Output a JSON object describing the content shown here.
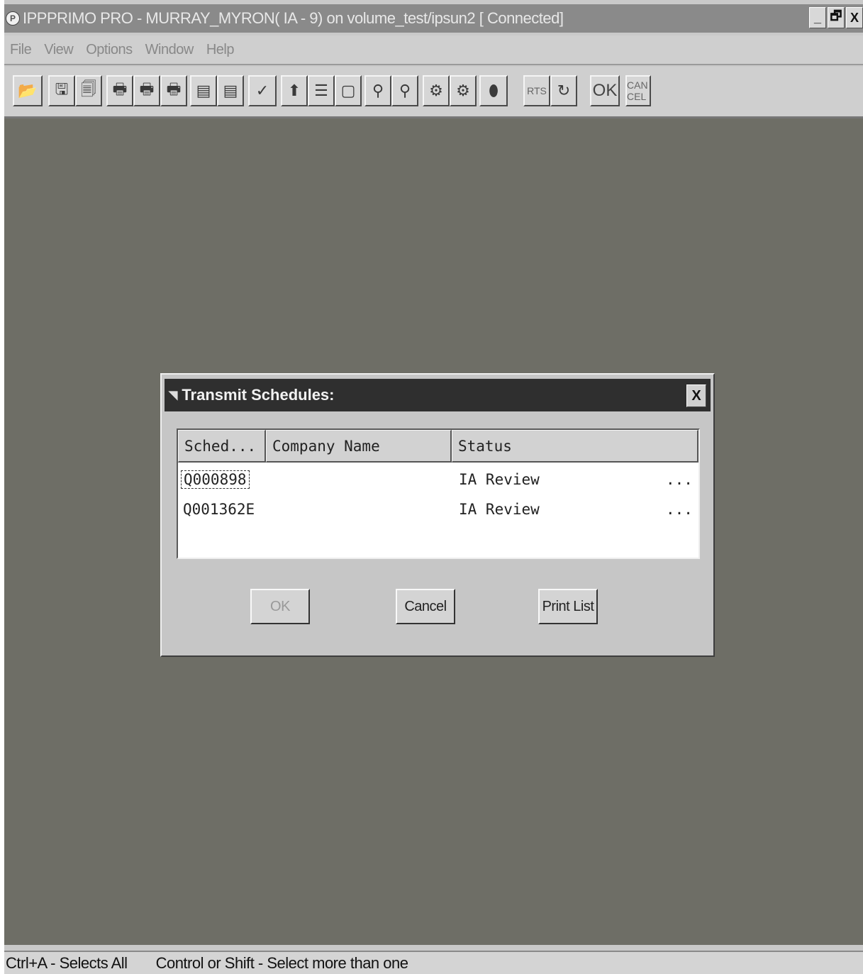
{
  "window": {
    "title": "IPPPRIMO PRO - MURRAY_MYRON( IA - 9) on volume_test/ipsun2 [ Connected]",
    "app_icon_letter": "P",
    "controls": [
      "_",
      "🗗",
      "X"
    ]
  },
  "menu": {
    "items": [
      "File",
      "View",
      "Options",
      "Window",
      "Help"
    ]
  },
  "toolbar": {
    "rts_label": "RTS",
    "ok_label": "OK",
    "cancel_label": "CAN CEL"
  },
  "dialog": {
    "title": "Transmit Schedules:",
    "close_label": "X",
    "columns": [
      "Sched...",
      "Company Name",
      "Status"
    ],
    "rows": [
      {
        "sched": "Q000898",
        "company": "",
        "status": "IA Review",
        "more": "..."
      },
      {
        "sched": "Q001362E",
        "company": "",
        "status": "IA Review",
        "more": "..."
      }
    ],
    "ok_label": "OK",
    "cancel_label": "Cancel",
    "print_label": "Print List"
  },
  "status_bar": {
    "hint_select_all": "Ctrl+A - Selects All",
    "hint_multi_select": "Control or Shift - Select more than one"
  }
}
